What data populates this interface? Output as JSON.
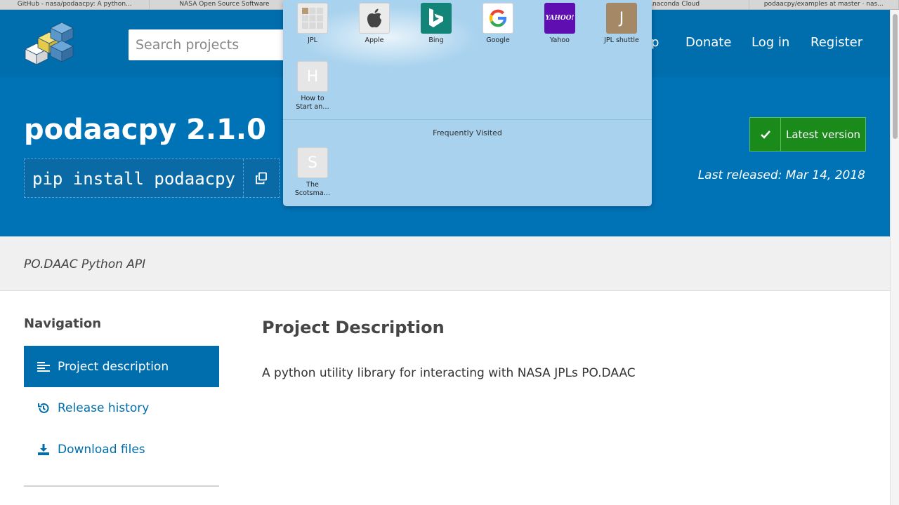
{
  "browser": {
    "tabs": [
      "GitHub - nasa/podaacpy: A python...",
      "NASA Open Source Software",
      "",
      "",
      "Anaconda Cloud",
      "podaacpy/examples at master · nas..."
    ]
  },
  "header": {
    "search_placeholder": "Search projects",
    "nav": {
      "help": "p",
      "donate": "Donate",
      "login": "Log in",
      "register": "Register"
    }
  },
  "package": {
    "title": "podaacpy 2.1.0",
    "pip_command": "pip install podaacpy",
    "latest_label": "Latest version",
    "released": "Last released: Mar 14, 2018",
    "summary": "PO.DAAC Python API"
  },
  "sidebar": {
    "heading": "Navigation",
    "items": [
      {
        "label": "Project description",
        "icon": "align-left-icon"
      },
      {
        "label": "Release history",
        "icon": "history-icon"
      },
      {
        "label": "Download files",
        "icon": "download-icon"
      }
    ]
  },
  "main": {
    "title": "Project Description",
    "text": "A python utility library for interacting with NASA JPLs PO.DAAC"
  },
  "favorites": {
    "items": [
      {
        "label": "JPL",
        "icon": "grid-icon",
        "color": "#ebebeb"
      },
      {
        "label": "Apple",
        "icon": "apple-icon",
        "color": "#ebebeb"
      },
      {
        "label": "Bing",
        "icon": "bing-icon",
        "color": "#138478"
      },
      {
        "label": "Google",
        "icon": "google-icon",
        "color": "#ffffff"
      },
      {
        "label": "Yahoo",
        "icon": "yahoo-icon",
        "color": "#5f0fb1",
        "tile_text": "YAHOO!"
      },
      {
        "label": "JPL shuttle",
        "icon": "letter-j-icon",
        "color": "#a58866",
        "tile_text": "J"
      },
      {
        "label": "How to Start an…",
        "icon": "letter-h-icon",
        "color": "#e6e6e6",
        "tile_text": "H"
      }
    ],
    "section_title": "Frequently Visited",
    "frequent": [
      {
        "label": "The Scotsma…",
        "icon": "letter-s-icon",
        "color": "#e6e6e6",
        "tile_text": "S"
      }
    ]
  },
  "colors": {
    "pypi_blue": "#006dad",
    "hero_blue": "#0073b7",
    "green": "#1a8a1a"
  }
}
